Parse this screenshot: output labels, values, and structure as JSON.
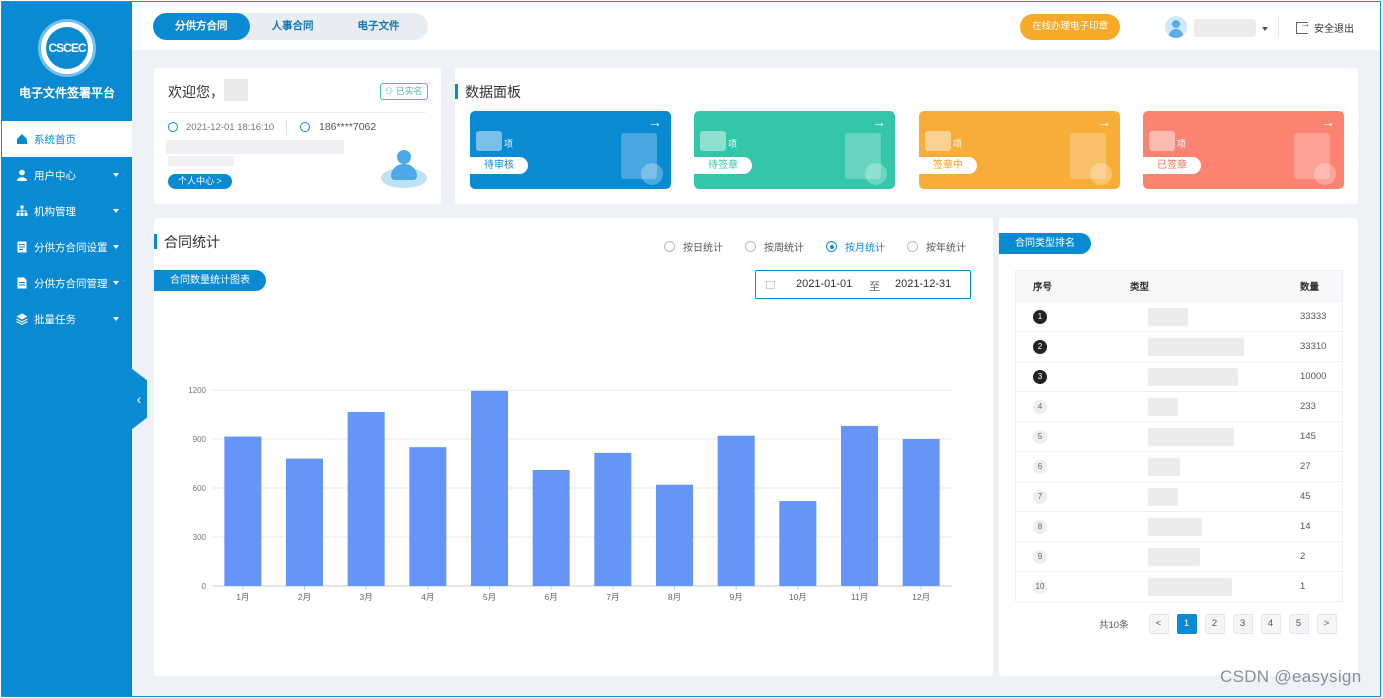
{
  "sidebar": {
    "logo_text": "CSCEC",
    "platform_title": "电子文件签署平台",
    "items": [
      {
        "label": "系统首页",
        "icon": "home-icon"
      },
      {
        "label": "用户中心",
        "icon": "user-icon"
      },
      {
        "label": "机构管理",
        "icon": "org-icon"
      },
      {
        "label": "分供方合同设置",
        "icon": "contract-settings-icon"
      },
      {
        "label": "分供方合同管理",
        "icon": "contract-manage-icon"
      },
      {
        "label": "批量任务",
        "icon": "layers-icon"
      }
    ]
  },
  "topbar": {
    "tabs": [
      "分供方合同",
      "人事合同",
      "电子文件"
    ],
    "seal_button": "在线办理电子印章",
    "logout": "安全退出"
  },
  "welcome": {
    "greeting": "欢迎您，",
    "verified": "已实名",
    "login_time": "2021-12-01 18:16:10",
    "phone": "186****7062",
    "personal_center": "个人中心 >"
  },
  "panel": {
    "title": "数据面板",
    "cards": [
      {
        "unit": "项",
        "label": "待审核",
        "color": "#0b8ad4",
        "text_color": "#0b8ad4"
      },
      {
        "unit": "项",
        "label": "待签章",
        "color": "#33c6a8",
        "text_color": "#33c6a8"
      },
      {
        "unit": "项",
        "label": "签章中",
        "color": "#f9ad39",
        "text_color": "#f39a16"
      },
      {
        "unit": "项",
        "label": "已签章",
        "color": "#fa8371",
        "text_color": "#f5705c"
      }
    ]
  },
  "stats": {
    "title": "合同统计",
    "chart_tab": "合同数量统计图表",
    "radios": [
      "按日统计",
      "按周统计",
      "按月统计",
      "按年统计"
    ],
    "selected_radio": "按月统计",
    "date_start": "2021-01-01",
    "date_sep": "至",
    "date_end": "2021-12-31"
  },
  "chart_data": {
    "type": "bar",
    "categories": [
      "1月",
      "2月",
      "3月",
      "4月",
      "5月",
      "6月",
      "7月",
      "8月",
      "9月",
      "10月",
      "11月",
      "12月"
    ],
    "values": [
      915,
      780,
      1065,
      850,
      1195,
      710,
      815,
      620,
      920,
      520,
      980,
      900
    ],
    "ylim": [
      0,
      1200
    ],
    "yticks": [
      0,
      300,
      600,
      900,
      1200
    ],
    "bar_color": "#6495f7",
    "grid": true
  },
  "ranking": {
    "title": "合同类型排名",
    "headers": {
      "no": "序号",
      "type": "类型",
      "count": "数量"
    },
    "rows": [
      {
        "no": "1",
        "count": "33333"
      },
      {
        "no": "2",
        "count": "33310"
      },
      {
        "no": "3",
        "count": "10000"
      },
      {
        "no": "4",
        "count": "233"
      },
      {
        "no": "5",
        "count": "145"
      },
      {
        "no": "6",
        "count": "27"
      },
      {
        "no": "7",
        "count": "45"
      },
      {
        "no": "8",
        "count": "14"
      },
      {
        "no": "9",
        "count": "2"
      },
      {
        "no": "10",
        "count": "1"
      }
    ],
    "total": "共10条",
    "pages": [
      "<",
      "1",
      "2",
      "3",
      "4",
      "5",
      ">"
    ],
    "current_page": "1"
  },
  "watermark": "CSDN @easysign"
}
